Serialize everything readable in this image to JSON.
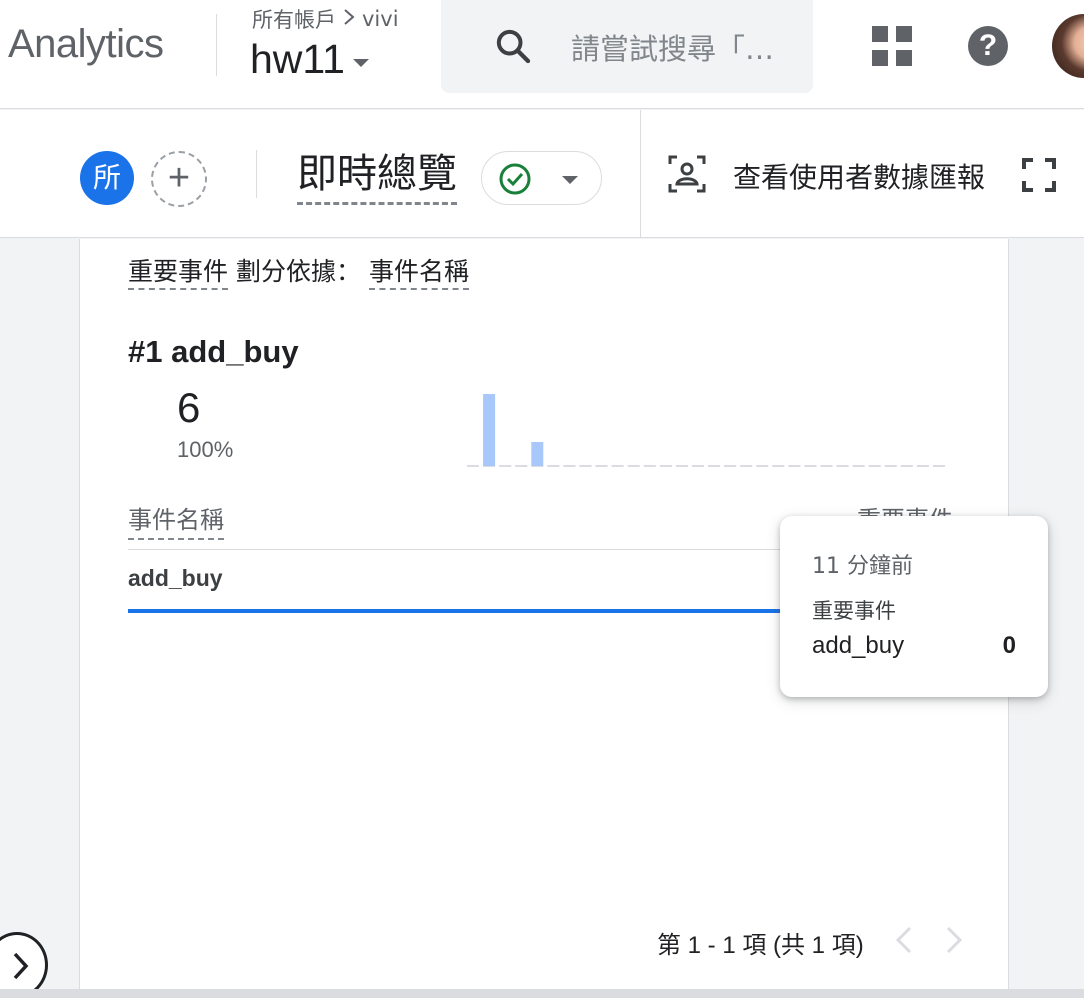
{
  "header": {
    "app_name": "Analytics",
    "breadcrumb_root": "所有帳戶",
    "breadcrumb_account": "vivi",
    "property_name": "hw11",
    "search_placeholder": "請嘗試搜尋「…",
    "icons": [
      "search-icon",
      "apps-icon",
      "help-icon",
      "avatar"
    ]
  },
  "subheader": {
    "segment_chip": "所",
    "page_title": "即時總覽",
    "status": "check-circle-icon",
    "snapshot_label": "查看使用者數據匯報"
  },
  "card": {
    "title_metric": "重要事件",
    "title_mid": "劃分依據：",
    "title_dimension": "事件名稱",
    "rank": "#1",
    "top_name": "add_buy",
    "top_value": "6",
    "top_percent": "100%",
    "col_dimension": "事件名稱",
    "col_metric": "重要事件",
    "rows": [
      {
        "name": "add_buy"
      }
    ],
    "pagination": "第 1 - 1 項 (共 1 項)"
  },
  "tooltip": {
    "time": "11 分鐘前",
    "metric": "重要事件",
    "name": "add_buy",
    "value": "0"
  },
  "chart_data": {
    "type": "bar",
    "values": [
      0,
      3,
      0,
      0,
      1,
      0,
      0,
      0,
      0,
      0,
      0,
      0,
      0,
      0,
      0,
      0,
      0,
      0,
      0,
      0,
      0,
      0,
      0,
      0,
      0,
      0,
      0,
      0,
      0,
      0
    ],
    "bar_color": "#a8c7fa"
  },
  "colors": {
    "accent": "#1a73e8",
    "status_ok": "#188038"
  }
}
